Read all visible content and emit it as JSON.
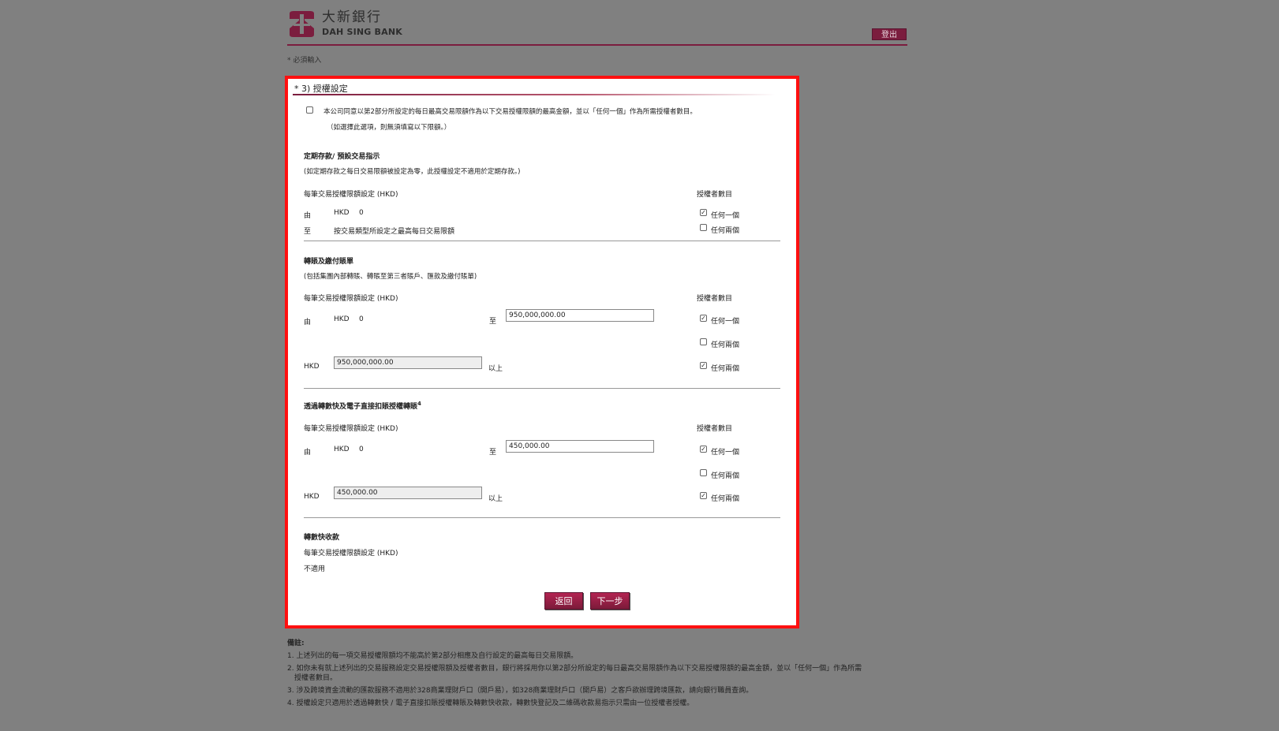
{
  "header": {
    "logo_cn": "大新銀行",
    "logo_en": "DAH SING BANK",
    "logout_label": "登出",
    "brand_color": "#7b1d3e"
  },
  "required_note": "* 必須輸入",
  "section": {
    "title": "* 3) 授權設定",
    "agree_text": "本公司同意以第2部分所設定的每日最高交易限額作為以下交易授權限額的最高金額，並以「任何一個」作為所需授權者數目。",
    "agree_sub": "（如選擇此選項，則無須填寫以下限額。）",
    "time_deposit": {
      "heading": "定期存款/ 預設交易指示",
      "note": "(如定期存款之每日交易限額被設定為零，此授權設定不適用於定期存款。)",
      "limit_label": "每筆交易授權限額設定 (HKD)",
      "count_label": "授權者數目",
      "from_label": "由",
      "from_currency": "HKD",
      "from_value": "0",
      "to_label": "至",
      "to_text": "按交易類型所設定之最高每日交易限額",
      "opt_any_one": "任何一個",
      "opt_any_two": "任何兩個"
    },
    "transfer": {
      "heading": "轉賬及繳付賬單",
      "note": "(包括集團內部轉賬、轉賬至第三者賬戶、匯款及繳付賬單)",
      "limit_label": "每筆交易授權限額設定 (HKD)",
      "count_label": "授權者數目",
      "from_label": "由",
      "from_currency": "HKD",
      "from_value": "0",
      "to_label": "至",
      "to_value": "950,000,000.00",
      "above_currency": "HKD",
      "above_value": "950,000,000.00",
      "above_label": "以上",
      "opt_any_one": "任何一個",
      "opt_any_two": "任何兩個",
      "opt_any_two_b": "任何兩個"
    },
    "fps": {
      "heading": "透過轉數快及電子直接扣賬授權轉賬",
      "heading_sup": "4",
      "limit_label": "每筆交易授權限額設定 (HKD)",
      "count_label": "授權者數目",
      "from_label": "由",
      "from_currency": "HKD",
      "from_value": "0",
      "to_label": "至",
      "to_value": "450,000.00",
      "above_currency": "HKD",
      "above_value": "450,000.00",
      "above_label": "以上",
      "opt_any_one": "任何一個",
      "opt_any_two": "任何兩個",
      "opt_any_two_b": "任何兩個"
    },
    "fps_collect": {
      "heading": "轉數快收款",
      "limit_label": "每筆交易授權限額設定 (HKD)",
      "value": "不適用"
    },
    "back_label": "返回",
    "next_label": "下一步"
  },
  "notes": {
    "title": "備註:",
    "items": [
      "1. 上述列出的每一項交易授權限額均不能高於第2部分相應及自行設定的最高每日交易限額。",
      "2. 如你未有就上述列出的交易服務設定交易授權限額及授權者數目，銀行將採用你以第2部分所設定的每日最高交易限額作為以下交易授權限額的最高金額，並以「任何一個」作為所需",
      "授權者數目。",
      "3. 涉及跨境資金流動的匯款服務不適用於328商業理財戶口（開戶易），如328商業理財戶口（開戶易）之客戶欲辦理跨境匯款，請向銀行職員查詢。",
      "4. 授權設定只適用於透過轉數快 / 電子直接扣賬授權轉賬及轉數快收款，轉數快登記及二維碼收款易指示只需由一位授權者授權。"
    ]
  }
}
